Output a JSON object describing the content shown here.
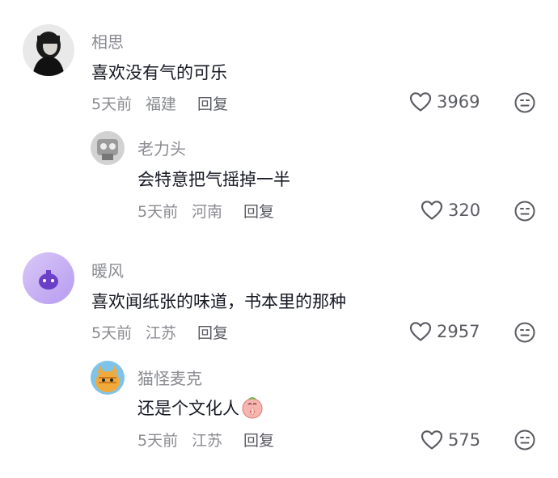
{
  "comments": [
    {
      "user": "相思",
      "text": "喜欢没有气的可乐",
      "time": "5天前",
      "location": "福建",
      "reply_label": "回复",
      "likes": "3969",
      "replies": [
        {
          "user": "老力头",
          "text": "会特意把气摇掉一半",
          "time": "5天前",
          "location": "河南",
          "reply_label": "回复",
          "likes": "320"
        }
      ]
    },
    {
      "user": "暖风",
      "text": "喜欢闻纸张的味道，书本里的那种",
      "time": "5天前",
      "location": "江苏",
      "reply_label": "回复",
      "likes": "2957",
      "replies": [
        {
          "user": "猫怪麦克",
          "text": "还是个文化人",
          "text_emoji": "shush-emoji",
          "time": "5天前",
          "location": "江苏",
          "reply_label": "回复",
          "likes": "575"
        }
      ]
    }
  ],
  "icons": {
    "like": "heart-outline-icon",
    "dislike": "meh-face-icon"
  },
  "colors": {
    "text": "#161823",
    "secondary": "#8a8b91",
    "icon": "#5a5b62"
  }
}
